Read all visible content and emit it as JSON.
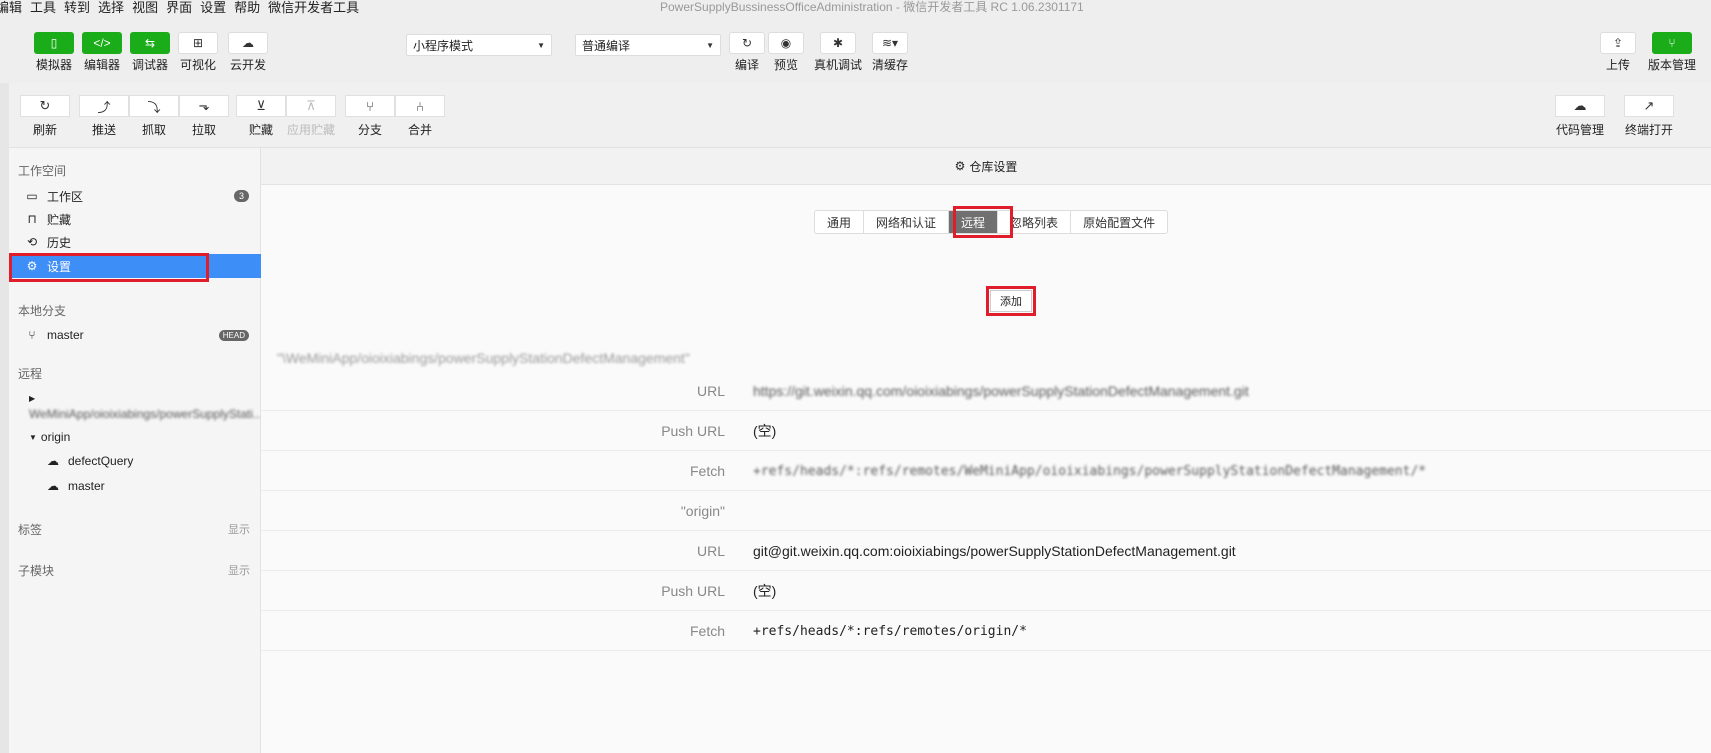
{
  "menubar": {
    "items": [
      "编辑",
      "工具",
      "转到",
      "选择",
      "视图",
      "界面",
      "设置",
      "帮助",
      "微信开发者工具"
    ],
    "title": "PowerSupplyBussinessOfficeAdministration - 微信开发者工具 RC 1.06.2301171"
  },
  "toolbar": {
    "simulator": "模拟器",
    "editor": "编辑器",
    "debugger": "调试器",
    "visual": "可视化",
    "cloud": "云开发",
    "mode_select": "小程序模式",
    "compile_select": "普通编译",
    "compile": "编译",
    "preview": "预览",
    "remote_debug": "真机调试",
    "clear_cache": "清缓存",
    "upload": "上传",
    "version_mgmt": "版本管理"
  },
  "git_toolbar": {
    "refresh": "刷新",
    "push": "推送",
    "fetch": "抓取",
    "pull": "拉取",
    "stash": "贮藏",
    "apply_stash": "应用贮藏",
    "branch": "分支",
    "merge": "合并",
    "code_mgmt": "代码管理",
    "terminal": "终端打开"
  },
  "sidebar": {
    "workspace_title": "工作空间",
    "items": [
      {
        "label": "工作区",
        "badge": "3"
      },
      {
        "label": "贮藏"
      },
      {
        "label": "历史"
      },
      {
        "label": "设置"
      }
    ],
    "local_branch_title": "本地分支",
    "branch": "master",
    "branch_badge": "HEAD",
    "remote_title": "远程",
    "remote_blurred": "WeMiniApp/oioixiabings/powerSupplyStati...",
    "origin": "origin",
    "origin_branches": [
      "defectQuery",
      "master"
    ],
    "tags_title": "标签",
    "tags_show": "显示",
    "submodule_title": "子模块",
    "submodule_show": "显示"
  },
  "content": {
    "header": "仓库设置",
    "tabs": [
      "通用",
      "网络和认证",
      "远程",
      "忽略列表",
      "原始配置文件"
    ],
    "add_button": "添加",
    "remote1": {
      "name": "\"\\WeMiniApp/oioixiabings/powerSupplyStationDefectManagement\"",
      "url": "https://git.weixin.qq.com/oioixiabings/powerSupplyStationDefectManagement.git",
      "push_url": "(空)",
      "fetch": "+refs/heads/*:refs/remotes/WeMiniApp/oioixiabings/powerSupplyStationDefectManagement/*"
    },
    "remote2": {
      "name": "\"origin\"",
      "url": "git@git.weixin.qq.com:oioixiabings/powerSupplyStationDefectManagement.git",
      "push_url": "(空)",
      "fetch": "+refs/heads/*:refs/remotes/origin/*"
    },
    "labels": {
      "url": "URL",
      "push_url": "Push URL",
      "fetch": "Fetch"
    }
  }
}
